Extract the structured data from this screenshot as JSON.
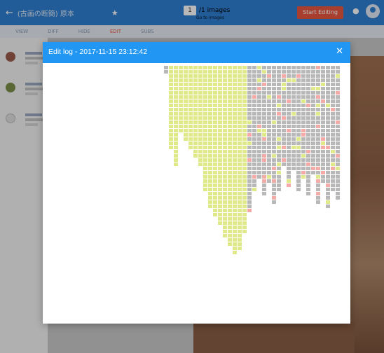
{
  "topbar": {
    "back_icon": "arrow-left-icon",
    "title": "(古画の断簡) 原本",
    "star_icon": "star-icon",
    "page_current": "1",
    "page_total_text": "/1 images",
    "page_sub": "Go to images",
    "start_button": "Start Editing",
    "pin_icon": "pin-icon",
    "user_icon": "user-icon"
  },
  "tabs": [
    "VIEW",
    "DIFF",
    "HIDE",
    "EDIT",
    "SUBS"
  ],
  "modal": {
    "title": "Edit log - 2017-11-15 23:12:42",
    "close_icon": "close-icon",
    "close_symbol": "✕"
  },
  "colors": {
    "topbar": "#2f7fd3",
    "modal_header": "#2196f3",
    "start_button": "#e9573f",
    "highlight_add": "#dfe98a",
    "highlight_del": "#f4aaa6"
  }
}
